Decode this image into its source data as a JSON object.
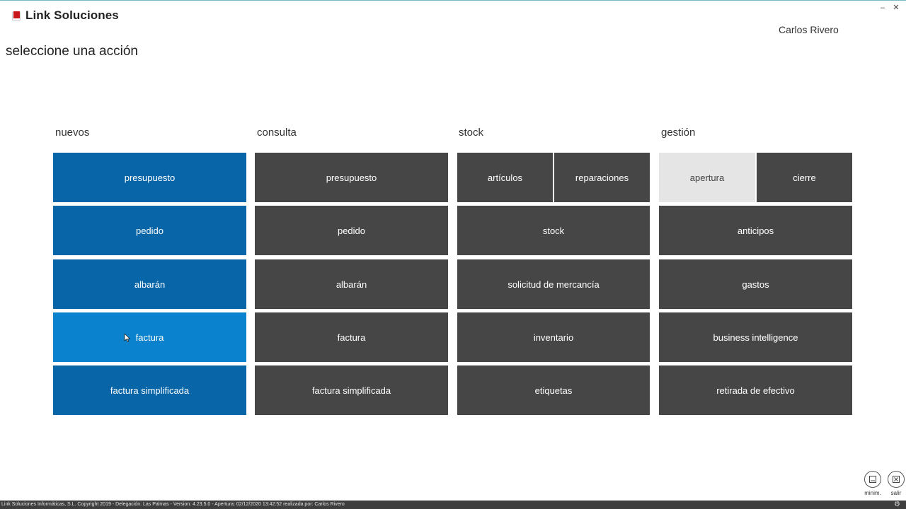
{
  "app": {
    "title": "Link Soluciones",
    "user": "Carlos Rivero"
  },
  "window": {
    "minimize_glyph": "–",
    "close_glyph": "✕"
  },
  "page": {
    "title": "seleccione una acción"
  },
  "columns": {
    "nuevos": {
      "header": "nuevos",
      "tiles": [
        "presupuesto",
        "pedido",
        "albarán",
        "factura",
        "factura simplificada"
      ]
    },
    "consulta": {
      "header": "consulta",
      "tiles": [
        "presupuesto",
        "pedido",
        "albarán",
        "factura",
        "factura simplificada"
      ]
    },
    "stock": {
      "header": "stock",
      "top_tiles": [
        "artículos",
        "reparaciones"
      ],
      "tiles": [
        "stock",
        "solicitud de mercancía",
        "inventario",
        "etiquetas"
      ]
    },
    "gestion": {
      "header": "gestión",
      "top_tiles": [
        "apertura",
        "cierre"
      ],
      "tiles": [
        "anticipos",
        "gastos",
        "business intelligence",
        "retirada de efectivo"
      ]
    }
  },
  "corner_buttons": {
    "minimize_label": "minim.",
    "exit_label": "salir"
  },
  "status_bar": {
    "text": "Link Soluciones Informáticas, S.L. Copyright 2019 - Delegación:  Las Palmas - Version: 4.23.5.0 - Apertura: 02/12/2020 13:42:52 realizada por: Carlos Rivero"
  },
  "colors": {
    "nuevos_tile": "#0765a8",
    "nuevos_tile_hover": "#0a82ce",
    "dark_tile": "#464646",
    "disabled_tile": "#e5e5e5",
    "brand_red": "#c8161d",
    "status_bar": "#3e3e3e"
  },
  "icons": {
    "logo": "red-square-logo-icon",
    "minimize": "minimize-icon",
    "exit": "exit-icon",
    "settings": "gear-icon",
    "cursor": "mouse-pointer-icon"
  }
}
